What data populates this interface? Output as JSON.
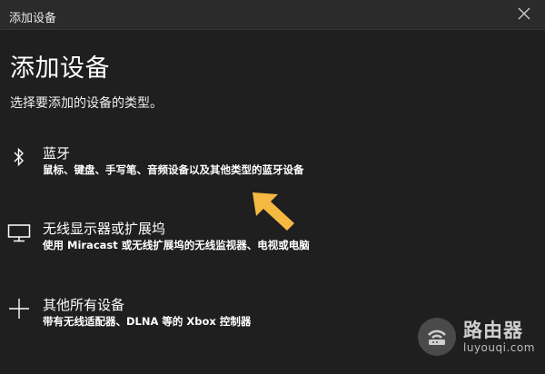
{
  "window": {
    "title": "添加设备",
    "close_icon": "close-icon"
  },
  "page": {
    "heading": "添加设备",
    "subtitle": "选择要添加的设备的类型。"
  },
  "options": [
    {
      "icon": "bluetooth-icon",
      "label": "蓝牙",
      "description": "鼠标、键盘、手写笔、音频设备以及其他类型的蓝牙设备"
    },
    {
      "icon": "monitor-icon",
      "label": "无线显示器或扩展坞",
      "description": "使用 Miracast 或无线扩展坞的无线监视器、电视或电脑"
    },
    {
      "icon": "plus-icon",
      "label": "其他所有设备",
      "description": "带有无线适配器、DLNA 等的 Xbox 控制器"
    }
  ],
  "annotation": {
    "icon": "pointer-arrow-icon",
    "color": "#f5b942"
  },
  "watermark": {
    "logo_icon": "router-logo-icon",
    "text": "路由器",
    "url": "luyouqi.com"
  }
}
